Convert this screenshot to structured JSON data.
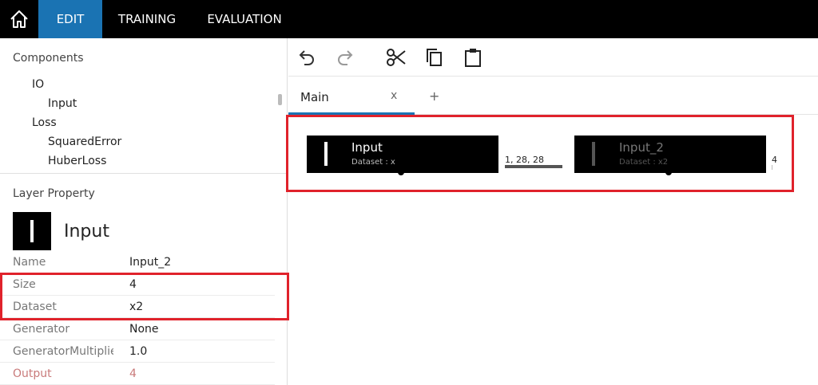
{
  "nav": {
    "home_icon": "home-icon",
    "tabs": [
      "EDIT",
      "TRAINING",
      "EVALUATION"
    ],
    "active_tab": "EDIT",
    "accent": "#1a73b3"
  },
  "components": {
    "title": "Components",
    "tree": [
      {
        "label": "IO",
        "level": 1
      },
      {
        "label": "Input",
        "level": 2
      },
      {
        "label": "Loss",
        "level": 1
      },
      {
        "label": "SquaredError",
        "level": 2
      },
      {
        "label": "HuberLoss",
        "level": 2
      }
    ]
  },
  "layer_property": {
    "title": "Layer Property",
    "layer_type": "Input",
    "properties": [
      {
        "key": "Name",
        "value": "Input_2"
      },
      {
        "key": "Size",
        "value": "4"
      },
      {
        "key": "Dataset",
        "value": "x2"
      },
      {
        "key": "Generator",
        "value": "None"
      },
      {
        "key": "GeneratorMultiplier",
        "value": "1.0"
      },
      {
        "key": "Output",
        "value": "4"
      }
    ]
  },
  "toolbar": {
    "icons": [
      "undo-icon",
      "redo-icon",
      "cut-icon",
      "copy-icon",
      "paste-icon"
    ]
  },
  "document_tabs": {
    "tabs": [
      {
        "label": "Main",
        "close": "x"
      }
    ],
    "add": "+"
  },
  "graph": {
    "nodes": [
      {
        "title": "Input",
        "subtitle": "Dataset : x",
        "selected": false
      },
      {
        "title": "Input_2",
        "subtitle": "Dataset : x2",
        "selected": true
      }
    ],
    "edge_label": "1, 28, 28",
    "output_label": "4"
  },
  "highlight_color": "#e0222b"
}
